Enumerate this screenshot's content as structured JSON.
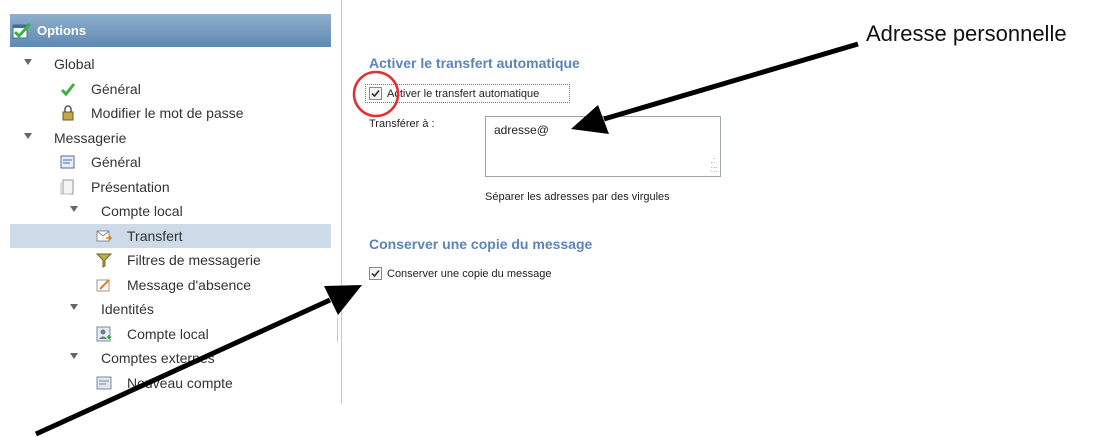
{
  "tree": {
    "header": "Options",
    "items": [
      {
        "label": "Global",
        "level": 0,
        "expandable": true,
        "icon": "none"
      },
      {
        "label": "Général",
        "level": 1,
        "icon": "checkmark-icon"
      },
      {
        "label": "Modifier le mot de passe",
        "level": 1,
        "icon": "lock-icon"
      },
      {
        "label": "Messagerie",
        "level": 0,
        "expandable": true,
        "icon": "none"
      },
      {
        "label": "Général",
        "level": 1,
        "icon": "mail-settings-icon"
      },
      {
        "label": "Présentation",
        "level": 1,
        "icon": "page-icon"
      },
      {
        "label": "Compte local",
        "level": 1,
        "expandable": true,
        "icon": "none"
      },
      {
        "label": "Transfert",
        "level": 2,
        "icon": "forward-mail-icon",
        "selected": true
      },
      {
        "label": "Filtres de messagerie",
        "level": 2,
        "icon": "filter-icon"
      },
      {
        "label": "Message d'absence",
        "level": 2,
        "icon": "absence-icon"
      },
      {
        "label": "Identités",
        "level": 1,
        "expandable": true,
        "icon": "none"
      },
      {
        "label": "Compte local",
        "level": 2,
        "icon": "identity-icon"
      },
      {
        "label": "Comptes externes",
        "level": 1,
        "expandable": true,
        "icon": "none"
      },
      {
        "label": "Nouveau compte",
        "level": 2,
        "icon": "new-account-icon"
      }
    ]
  },
  "forwarding": {
    "section_title": "Activer le transfert automatique",
    "checkbox_label": "Activer le transfert automatique",
    "checkbox_checked": true,
    "forward_to_label": "Transférer à :",
    "forward_to_value": "adresse@",
    "hint": "Séparer les adresses par des virgules"
  },
  "keep_copy": {
    "section_title": "Conserver une copie du message",
    "checkbox_label": "Conserver une copie du message",
    "checkbox_checked": true
  },
  "annotation": {
    "label": "Adresse personnelle",
    "circle_color": "#e03030",
    "arrow_color": "#000000"
  }
}
